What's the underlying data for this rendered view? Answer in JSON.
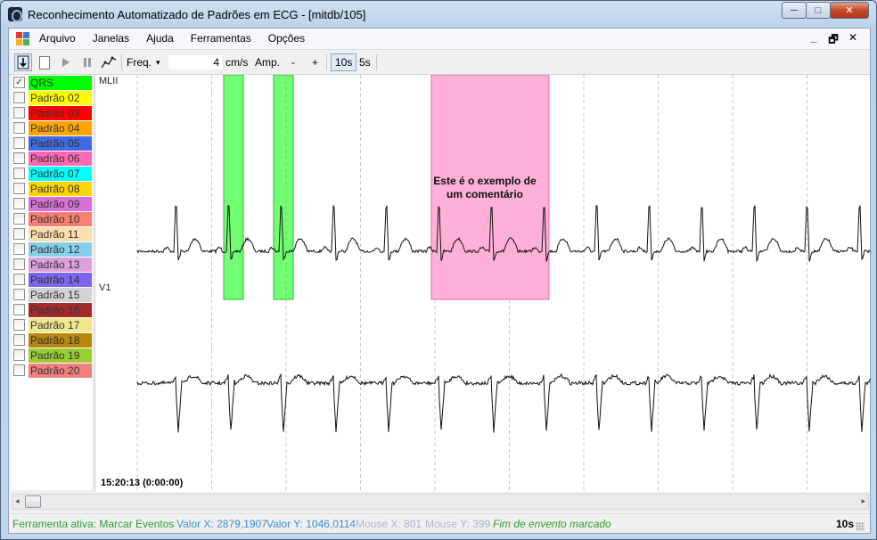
{
  "window": {
    "title": "Reconhecimento Automatizado de Padrões em ECG  - [mitdb/105]",
    "buttons": {
      "minimize": "─",
      "maximize": "□",
      "close": "✕"
    }
  },
  "menu": {
    "items": [
      "Arquivo",
      "Janelas",
      "Ajuda",
      "Ferramentas",
      "Opções"
    ],
    "mdi": {
      "minimize": "_",
      "restore": "🗗",
      "close": "✕"
    }
  },
  "toolbar": {
    "freq_label": "Freq.",
    "freq_dropdown": "▾",
    "freq_value": "4",
    "freq_unit": "cm/s",
    "amp_label": "Amp.",
    "amp_minus": "-",
    "amp_plus": "+",
    "scale_10s": "10s",
    "scale_5s": "5s"
  },
  "legend": [
    {
      "label": "QRS",
      "color": "#00ff00",
      "checked": true
    },
    {
      "label": "Padrão 02",
      "color": "#ffff00",
      "checked": false
    },
    {
      "label": "Padrão 03",
      "color": "#ff0000",
      "checked": false
    },
    {
      "label": "Padrão 04",
      "color": "#ffa500",
      "checked": false
    },
    {
      "label": "Padrão 05",
      "color": "#4169e1",
      "checked": false
    },
    {
      "label": "Padrão 06",
      "color": "#ff69b4",
      "checked": false
    },
    {
      "label": "Padrão 07",
      "color": "#00ffff",
      "checked": false
    },
    {
      "label": "Padrão 08",
      "color": "#ffd700",
      "checked": false
    },
    {
      "label": "Padrão 09",
      "color": "#da70d6",
      "checked": false
    },
    {
      "label": "Padrão 10",
      "color": "#fa8072",
      "checked": false
    },
    {
      "label": "Padrão 11",
      "color": "#ffdead",
      "checked": false
    },
    {
      "label": "Padrão 12",
      "color": "#87ceeb",
      "checked": false
    },
    {
      "label": "Padrão 13",
      "color": "#dda0dd",
      "checked": false
    },
    {
      "label": "Padrão 14",
      "color": "#7b68ee",
      "checked": false
    },
    {
      "label": "Padrão 15",
      "color": "#d3d3d3",
      "checked": false
    },
    {
      "label": "Padrão 16",
      "color": "#a52a2a",
      "checked": false
    },
    {
      "label": "Padrão 17",
      "color": "#f0e68c",
      "checked": false
    },
    {
      "label": "Padrão 18",
      "color": "#b8860b",
      "checked": false
    },
    {
      "label": "Padrão 19",
      "color": "#9acd32",
      "checked": false
    },
    {
      "label": "Padrão 20",
      "color": "#f08080",
      "checked": false
    }
  ],
  "ecg": {
    "leads": [
      "MLII",
      "V1"
    ],
    "start_time": "15:20:13 (0:00:00)",
    "comment": "Este é o exemplo de um comentário",
    "colors": {
      "qrs_marker": "#00ff00",
      "comment_box": "#ffb0d8",
      "trace": "#111111"
    }
  },
  "status": {
    "tool": "Ferramenta ativa: Marcar Eventos",
    "valor_x": "Valor X: 2879,1907",
    "valor_y": "Valor Y: 1046,0114",
    "mouse_x": "Mouse X: 801",
    "mouse_y": "Mouse Y: 399",
    "message": "Fim de envento marcado",
    "scale": "10s"
  }
}
